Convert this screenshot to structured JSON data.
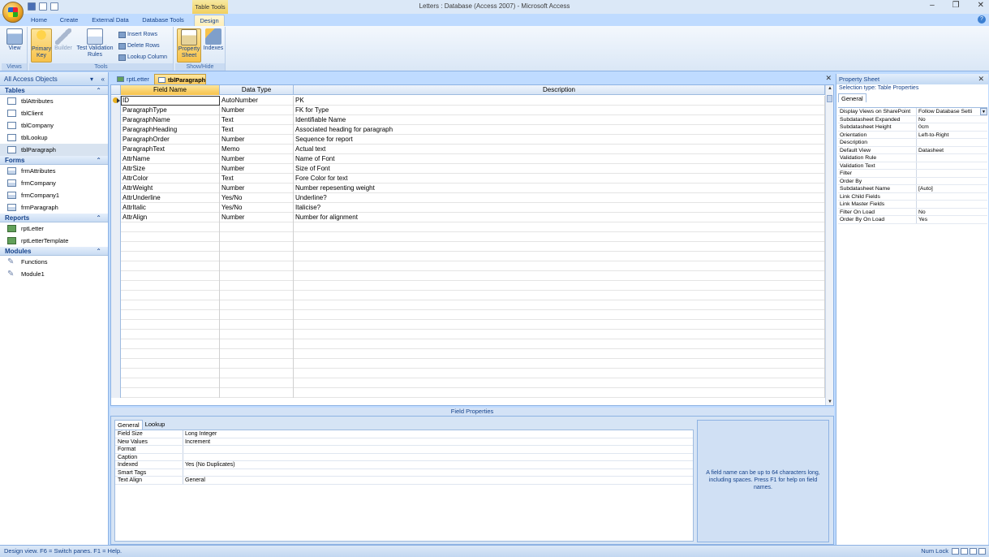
{
  "window": {
    "title": "Letters : Database (Access 2007) - Microsoft Access",
    "contextual_group": "Table Tools",
    "minimize": "–",
    "restore": "❐",
    "close": "✕"
  },
  "tabs": [
    "Home",
    "Create",
    "External Data",
    "Database Tools",
    "Design"
  ],
  "ribbon": {
    "views": {
      "view": "View",
      "label": "Views"
    },
    "tools": {
      "primary_key": "Primary Key",
      "builder": "Builder",
      "test_validation": "Test Validation Rules",
      "insert_rows": "Insert Rows",
      "delete_rows": "Delete Rows",
      "lookup_column": "Lookup Column",
      "label": "Tools"
    },
    "showhide": {
      "property_sheet": "Property Sheet",
      "indexes": "Indexes",
      "label": "Show/Hide"
    }
  },
  "nav": {
    "title": "All Access Objects",
    "groups": [
      {
        "name": "Tables",
        "items": [
          "tblAttributes",
          "tblClient",
          "tblCompany",
          "tblLookup",
          "tblParagraph"
        ]
      },
      {
        "name": "Forms",
        "items": [
          "frmAttributes",
          "frmCompany",
          "frmCompany1",
          "frmParagraph"
        ]
      },
      {
        "name": "Reports",
        "items": [
          "rptLetter",
          "rptLetterTemplate"
        ]
      },
      {
        "name": "Modules",
        "items": [
          "Functions",
          "Module1"
        ]
      }
    ]
  },
  "doc_tabs": [
    "rptLetter",
    "tblParagraph"
  ],
  "grid": {
    "headers": [
      "Field Name",
      "Data Type",
      "Description"
    ],
    "rows": [
      [
        "ID",
        "AutoNumber",
        "PK"
      ],
      [
        "ParagraphType",
        "Number",
        "FK for Type"
      ],
      [
        "ParagraphName",
        "Text",
        "Identifiable Name"
      ],
      [
        "ParagraphHeading",
        "Text",
        "Associated heading for paragraph"
      ],
      [
        "ParagraphOrder",
        "Number",
        "Sequence for report"
      ],
      [
        "ParagraphText",
        "Memo",
        "Actual text"
      ],
      [
        "AttrName",
        "Number",
        "Name of Font"
      ],
      [
        "AttrSize",
        "Number",
        "Size of Font"
      ],
      [
        "AttrColor",
        "Text",
        "Fore Color for text"
      ],
      [
        "AttrWeight",
        "Number",
        "Number repesenting weight"
      ],
      [
        "AttrUnderline",
        "Yes/No",
        "Underline?"
      ],
      [
        "AttrItalic",
        "Yes/No",
        "Italicise?"
      ],
      [
        "AttrAlign",
        "Number",
        "Number for alignment"
      ]
    ]
  },
  "field_properties": {
    "title": "Field Properties",
    "tabs": [
      "General",
      "Lookup"
    ],
    "rows": [
      [
        "Field Size",
        "Long Integer"
      ],
      [
        "New Values",
        "Increment"
      ],
      [
        "Format",
        ""
      ],
      [
        "Caption",
        ""
      ],
      [
        "Indexed",
        "Yes (No Duplicates)"
      ],
      [
        "Smart Tags",
        ""
      ],
      [
        "Text Align",
        "General"
      ]
    ],
    "help": "A field name can be up to 64 characters long, including spaces.  Press F1 for help on field names."
  },
  "property_sheet": {
    "title": "Property Sheet",
    "selection": "Selection type:  Table Properties",
    "tab": "General",
    "rows": [
      [
        "Display Views on SharePoint",
        "Follow Database Setti"
      ],
      [
        "Subdatasheet Expanded",
        "No"
      ],
      [
        "Subdatasheet Height",
        "0cm"
      ],
      [
        "Orientation",
        "Left-to-Right"
      ],
      [
        "Description",
        ""
      ],
      [
        "Default View",
        "Datasheet"
      ],
      [
        "Validation Rule",
        ""
      ],
      [
        "Validation Text",
        ""
      ],
      [
        "Filter",
        ""
      ],
      [
        "Order By",
        ""
      ],
      [
        "Subdatasheet Name",
        "[Auto]"
      ],
      [
        "Link Child Fields",
        ""
      ],
      [
        "Link Master Fields",
        ""
      ],
      [
        "Filter On Load",
        "No"
      ],
      [
        "Order By On Load",
        "Yes"
      ]
    ]
  },
  "status": {
    "text": "Design view.  F6 = Switch panes.  F1 = Help.",
    "numlock": "Num Lock"
  }
}
